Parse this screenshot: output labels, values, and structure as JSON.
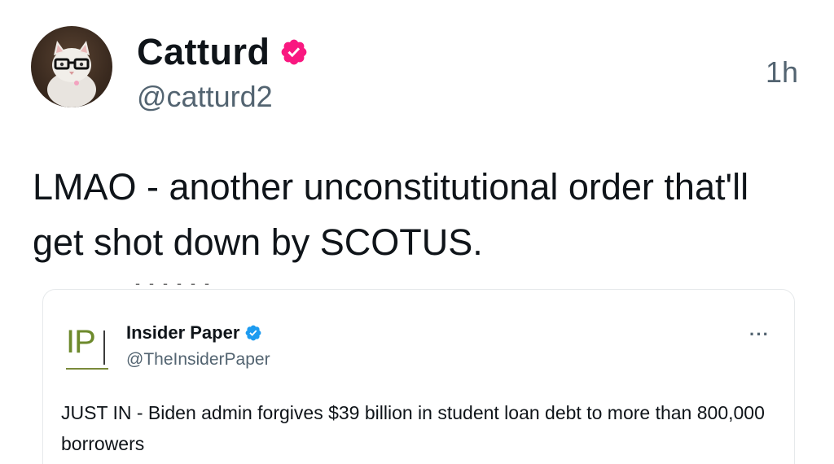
{
  "post": {
    "author": {
      "display_name": "Catturd",
      "handle": "@catturd2",
      "verified_badge_icon": "verified-badge-icon",
      "verified_color": "#f91880",
      "avatar_icon": "cat-with-glasses-avatar"
    },
    "timestamp": "1h",
    "text": "LMAO - another unconstitutional order that'll get shot down by SCOTUS."
  },
  "quoted_post": {
    "author": {
      "display_name": "Insider Paper",
      "handle": "@TheInsiderPaper",
      "logo_text": "IP",
      "verified_badge_icon": "verified-badge-icon",
      "verified_color": "#1d9bf0"
    },
    "more_menu_icon": "more-horizontal-icon",
    "more_menu_label": "···",
    "text": "JUST IN - Biden admin forgives $39 billion in student loan debt to more than 800,000 borrowers"
  }
}
